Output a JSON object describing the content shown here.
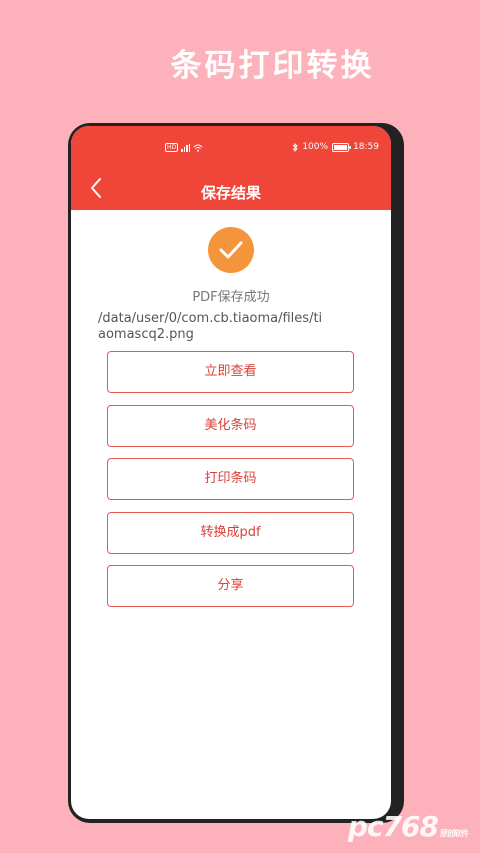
{
  "promo": {
    "title": "条码打印转换"
  },
  "status_bar": {
    "battery": "100%",
    "time": "18:59",
    "network": "HD"
  },
  "appbar": {
    "title": "保存结果"
  },
  "result": {
    "message": "PDF保存成功",
    "path": "/data/user/0/com.cb.tiaoma/files/tiaomascq2.png"
  },
  "actions": [
    {
      "label": "立即查看"
    },
    {
      "label": "美化条码"
    },
    {
      "label": "打印条码"
    },
    {
      "label": "转换成pdf"
    },
    {
      "label": "分享"
    }
  ],
  "watermark": {
    "text": "pc768",
    "sub": "原创软件"
  },
  "colors": {
    "background": "#fdb1bb",
    "appbar": "#f04539",
    "check": "#f4953b",
    "button_border": "#e35a52"
  }
}
